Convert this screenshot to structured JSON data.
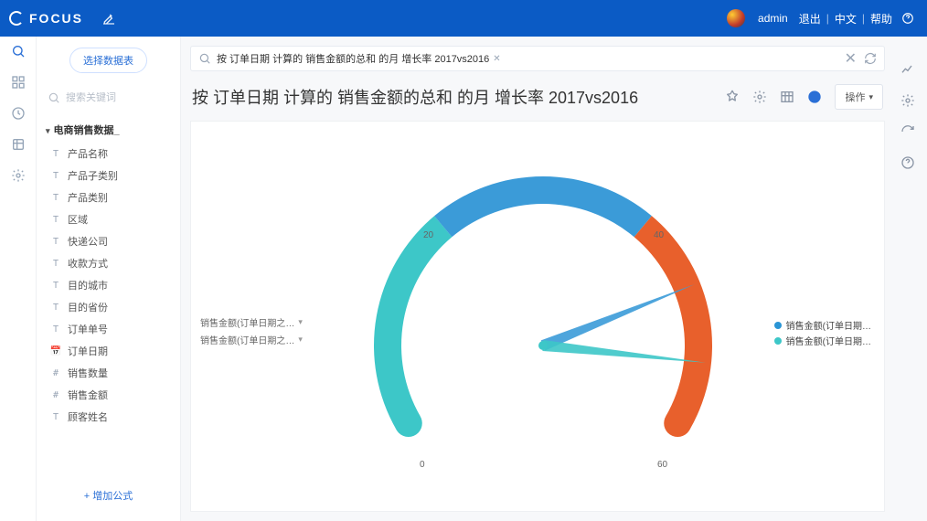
{
  "header": {
    "app_name": "FOCUS",
    "user": "admin",
    "links": {
      "logout": "退出",
      "lang": "中文",
      "help": "帮助"
    }
  },
  "sidebar": {
    "select_table_btn": "选择数据表",
    "search_placeholder": "搜索关键词",
    "group_title": "电商销售数据_",
    "fields": [
      {
        "type": "T",
        "label": "产品名称"
      },
      {
        "type": "T",
        "label": "产品子类别"
      },
      {
        "type": "T",
        "label": "产品类别"
      },
      {
        "type": "T",
        "label": "区域"
      },
      {
        "type": "T",
        "label": "快递公司"
      },
      {
        "type": "T",
        "label": "收款方式"
      },
      {
        "type": "T",
        "label": "目的城市"
      },
      {
        "type": "T",
        "label": "目的省份"
      },
      {
        "type": "T",
        "label": "订单单号"
      },
      {
        "type": "D",
        "label": "订单日期"
      },
      {
        "type": "#",
        "label": "销售数量"
      },
      {
        "type": "#",
        "label": "销售金额"
      },
      {
        "type": "T",
        "label": "顾客姓名"
      }
    ],
    "add_formula": "+ 增加公式"
  },
  "main": {
    "search_chip": "按  订单日期  计算的   销售金额的总和  的月  增长率  2017vs2016",
    "title": "按 订单日期 计算的 销售金额的总和 的月 增长率 2017vs2016",
    "actions_btn": "操作"
  },
  "series": [
    {
      "label": "销售金额(订单日期之…"
    },
    {
      "label": "销售金额(订单日期之…"
    }
  ],
  "legend": [
    {
      "color": "#2a95d5",
      "label": "销售金额(订单日期…"
    },
    {
      "color": "#3dc7c8",
      "label": "销售金额(订单日期…"
    }
  ],
  "chart_data": {
    "type": "gauge",
    "min": 0,
    "max": 60,
    "ticks": [
      0,
      20,
      40,
      60
    ],
    "segments": [
      {
        "from": 0,
        "to": 20,
        "color": "#3dc7c8"
      },
      {
        "from": 20,
        "to": 40,
        "color": "#3b9bd8"
      },
      {
        "from": 40,
        "to": 60,
        "color": "#e8602c"
      }
    ],
    "needles": [
      {
        "name": "销售金额(订单日期…)",
        "value": 47,
        "color": "#3b9bd8"
      },
      {
        "name": "销售金额(订单日期…)",
        "value": 54,
        "color": "#3dc7c8"
      }
    ],
    "title": "按 订单日期 计算的 销售金额的总和 的月 增长率 2017vs2016"
  }
}
